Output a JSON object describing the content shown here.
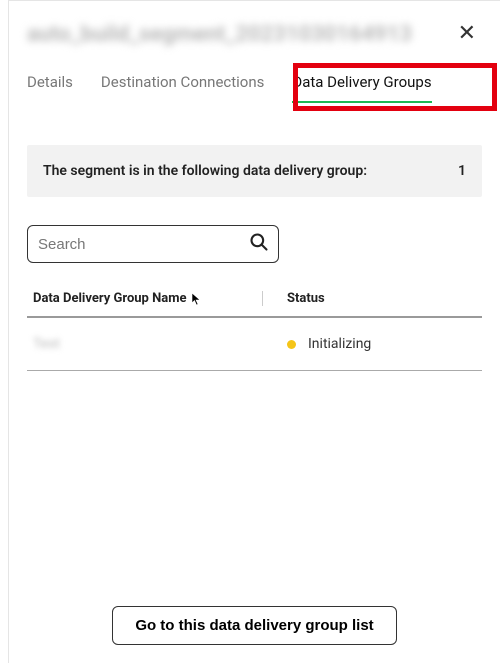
{
  "header": {
    "title": "auto_build_segment_20231030164913",
    "close_label": "✕"
  },
  "tabs": {
    "details": "Details",
    "destinations": "Destination Connections",
    "delivery": "Data Delivery Groups"
  },
  "info": {
    "message": "The segment is in the following data delivery group:",
    "count": "1"
  },
  "search": {
    "placeholder": "Search"
  },
  "table": {
    "headers": {
      "name": "Data Delivery Group Name",
      "status": "Status"
    },
    "rows": [
      {
        "name": "Test",
        "status": "Initializing",
        "status_color": "#f5c518"
      }
    ]
  },
  "footer": {
    "button_label": "Go to this data delivery group list"
  }
}
